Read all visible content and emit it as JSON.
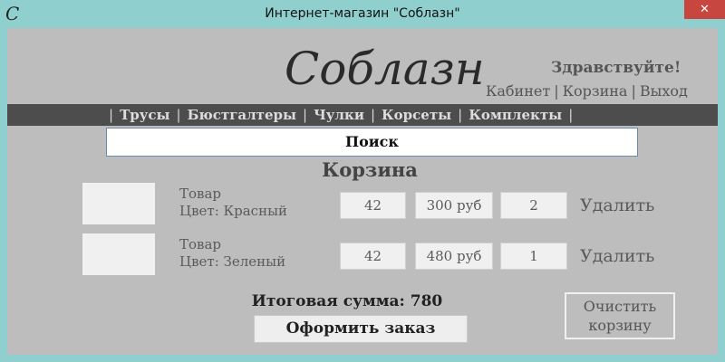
{
  "window": {
    "title": "Интернет-магазин \"Соблазн\"",
    "icon_glyph": "C",
    "close_label": "✕"
  },
  "header": {
    "logo": "Соблазн",
    "greeting": "Здравствуйте!",
    "links": [
      "Кабинет",
      "Корзина",
      "Выход"
    ]
  },
  "nav": {
    "items": [
      "Трусы",
      "Бюстгалтеры",
      "Чулки",
      "Корсеты",
      "Комплекты"
    ]
  },
  "search": {
    "label": "Поиск"
  },
  "cart": {
    "title": "Корзина",
    "items": [
      {
        "name": "Товар",
        "color": "Цвет: Красный",
        "size": "42",
        "price": "300 руб",
        "qty": "2",
        "delete": "Удалить"
      },
      {
        "name": "Товар",
        "color": "Цвет: Зеленый",
        "size": "42",
        "price": "480 руб",
        "qty": "1",
        "delete": "Удалить"
      }
    ],
    "total": "Итоговая сумма: 780",
    "order_button": "Оформить заказ",
    "clear_button_line1": "Очистить",
    "clear_button_line2": "корзину"
  },
  "colors": {
    "window_frame": "#8fd0ce",
    "client_bg": "#bdbdbd",
    "nav_bg": "#4d4d4d",
    "close_button": "#c7463f"
  }
}
